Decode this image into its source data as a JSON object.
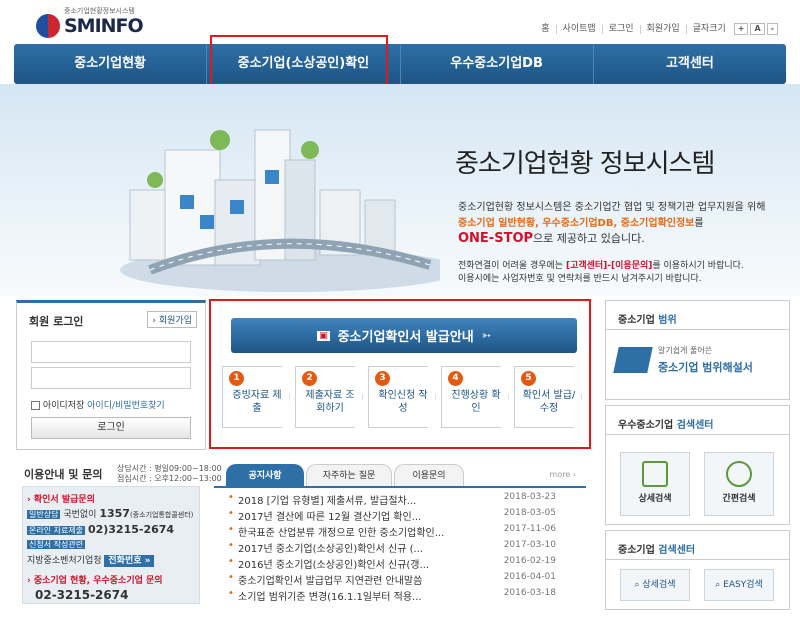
{
  "header": {
    "logo_small": "중소기업현황정보시스템",
    "logo_big": "SMINFO",
    "util": [
      "홈",
      "사이트맵",
      "로그인",
      "회원가입",
      "글자크기"
    ],
    "font_plus": "+",
    "font_a": "A",
    "font_minus": "-"
  },
  "nav": [
    "중소기업현황",
    "중소기업(소상공인)확인",
    "우수중소기업DB",
    "고객센터"
  ],
  "hero": {
    "title": "중소기업현황 정보시스템",
    "line1": "중소기업현황 정보시스템은 중소기업간 협업 및 정책기관 업무지원을 위해",
    "line2a": "중소기업 일반현황, 우수중소기업DB, 중소기업확인정보",
    "line2b": "를",
    "line3a": "ONE-STOP",
    "line3b": "으로 제공하고 있습니다.",
    "line4a": "전화연결이 어려울 경우에는 ",
    "line4b": "[고객센터]-[이용문의]",
    "line4c": "를 이용하시기 바랍니다.",
    "line5": "이용시에는 사업자번호 및 연락처를 반드시 남겨주시기 바랍니다."
  },
  "login": {
    "title": "회원 로그인",
    "join": "› 회원가입",
    "save_id": "아이디저장",
    "find": "아이디/비밀번호찾기",
    "button": "로그인"
  },
  "cs": {
    "title": "이용안내 및 문의",
    "hours1": "상담시간 : 평일09:00~18:00",
    "hours2": "점심시간 : 오후12:00~13:00",
    "q1": "확인서 발급문의",
    "tag1": "일반상담",
    "l1": "국번없이",
    "n1": "1357",
    "n1s": "(중소기업통합콜센터)",
    "tag2": "온라인 자료제출",
    "n2": "02)3215-2674",
    "tag3": "신청서 작성관련",
    "l3": "지방중소벤처기업청",
    "phone_btn": "전화번호 »",
    "q2": "중소기업 현황, 우수중소기업 문의",
    "n3": "02-3215-2674"
  },
  "issue": {
    "button": "중소기업확인서 발급안내",
    "steps": [
      {
        "n": "1",
        "label": "증빙자료 제출"
      },
      {
        "n": "2",
        "label": "제출자료 조회하기"
      },
      {
        "n": "3",
        "label": "확인신청 작성"
      },
      {
        "n": "4",
        "label": "진행상황 확인"
      },
      {
        "n": "5",
        "label": "확인서 발급/수정"
      }
    ]
  },
  "board": {
    "tabs": [
      "공지사항",
      "자주하는 질문",
      "이용문의"
    ],
    "more": "more ›",
    "rows": [
      {
        "title": "2018 [기업 유형별] 제출서류, 발급절차...",
        "date": "2018-03-23"
      },
      {
        "title": "2017년 결산에 따른 12월 결산기업 확인...",
        "date": "2018-03-05"
      },
      {
        "title": "한국표준 산업분류 개정으로 인한 중소기업확인...",
        "date": "2017-11-06"
      },
      {
        "title": "2017년 중소기업(소상공인)확인서 신규 (...",
        "date": "2017-03-10"
      },
      {
        "title": "2016년 중소기업(소상공인)확인서 신규(갱...",
        "date": "2016-02-19"
      },
      {
        "title": "중소기업확인서 발급업무 지연관련 안내말씀",
        "date": "2016-04-01"
      },
      {
        "title": "소기업 범위기준 변경(16.1.1일부터 적용...",
        "date": "2016-03-18"
      }
    ]
  },
  "right": {
    "range_title_a": "중소기업 ",
    "range_title_b": "범위",
    "range_sub": "알기쉽게 풀어쓴",
    "range_main": "중소기업 범위해설서",
    "search1_a": "우수중소기업 ",
    "search1_b": "검색센터",
    "detail": "상세검색",
    "simple": "간편검색",
    "search2_a": "중소기업 ",
    "search2_b": "검색센터",
    "detail2": "상세검색",
    "easy": "EASY검색"
  },
  "colors": {
    "primary": "#2e6fa6",
    "accent": "#e36b16",
    "highlight": "#e01a1a"
  }
}
